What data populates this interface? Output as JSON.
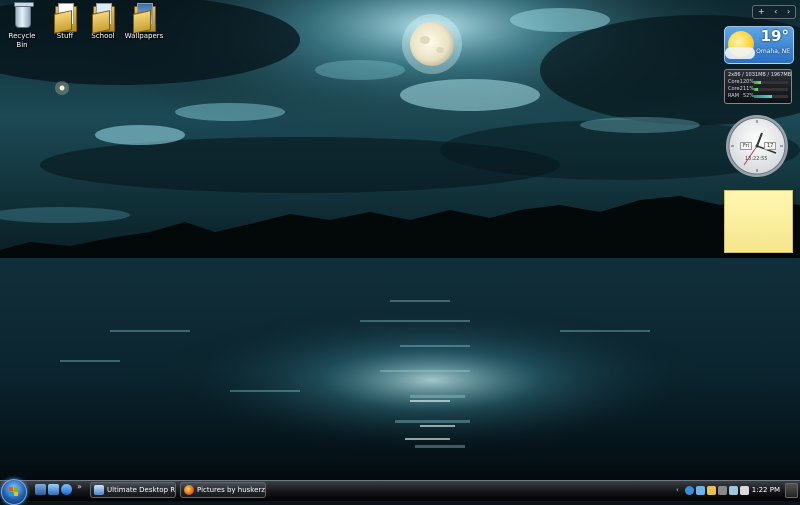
{
  "desktop": {
    "icons": [
      {
        "label": "Recycle Bin",
        "icon": "recycle-bin-icon"
      },
      {
        "label": "Stuff",
        "icon": "folder-icon"
      },
      {
        "label": "School",
        "icon": "folder-icon"
      },
      {
        "label": "Wallpapers",
        "icon": "folder-icon"
      }
    ]
  },
  "sidebar": {
    "controls": {
      "add": "+",
      "prev": "‹",
      "next": "›"
    },
    "weather": {
      "temp": "19°",
      "city": "Omaha, NE"
    },
    "meter": {
      "memory": "2x86 / 1031MB / 1967MB",
      "rows": [
        {
          "label": "Core1",
          "percent": "20%",
          "value": 0.2
        },
        {
          "label": "Core2",
          "percent": "11%",
          "value": 0.11
        },
        {
          "label": "RAM",
          "percent": "52%",
          "value": 0.52
        }
      ]
    },
    "clock": {
      "day": "Fri",
      "date": "17",
      "time": "13:22:55"
    }
  },
  "taskbar": {
    "overflow": "»",
    "windows": [
      {
        "label": "Ultimate Desktop Ri...",
        "icon": "explorer-window-icon"
      },
      {
        "label": "Pictures by huskerz8...",
        "icon": "firefox-icon"
      }
    ],
    "tray": {
      "time": "1:22 PM"
    }
  },
  "colors": {
    "sky_dark": "#06141c",
    "sky_light": "#7fd0e0",
    "water": "#0d2a35",
    "moon": "#f3eed8",
    "taskbar": "#15171a"
  }
}
